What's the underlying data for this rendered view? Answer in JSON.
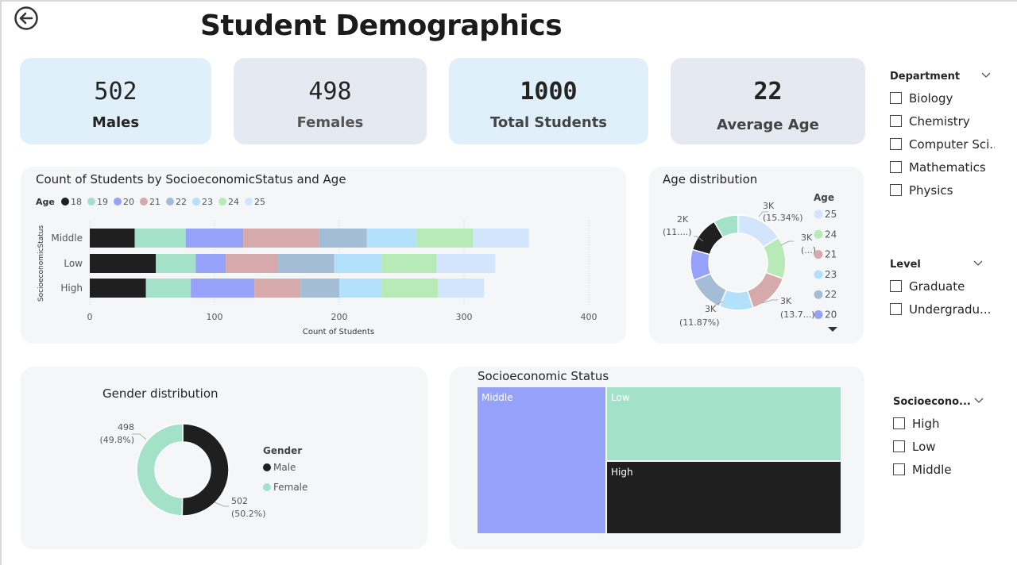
{
  "page": {
    "title": "Student Demographics"
  },
  "nav": {
    "back_icon": "back-arrow-icon"
  },
  "kpis": [
    {
      "value": "502",
      "label": "Males"
    },
    {
      "value": "498",
      "label": "Females"
    },
    {
      "value": "1000",
      "label": "Total Students"
    },
    {
      "value": "22",
      "label": "Average Age"
    }
  ],
  "colors": {
    "18": "#1f1f1f",
    "19": "#a3e2c9",
    "20": "#96a2f9",
    "21": "#d6a9aa",
    "22": "#a4bdd6",
    "23": "#b3e0fb",
    "24": "#b8eab8",
    "25": "#d2e5fc",
    "male": "#1f1f1f",
    "female": "#a3e2c9"
  },
  "bar_chart": {
    "title": "Count of Students by SocioeconomicStatus and Age",
    "legend_title": "Age",
    "legend": [
      "18",
      "19",
      "20",
      "21",
      "22",
      "23",
      "24",
      "25"
    ],
    "xlabel": "Count of Students",
    "ylabel": "SocioeconomicStatus",
    "ticks": [
      "0",
      "100",
      "200",
      "300",
      "400"
    ]
  },
  "age_chart": {
    "title": "Age distribution",
    "legend_title": "Age",
    "legend": [
      "25",
      "24",
      "21",
      "23",
      "22",
      "20"
    ],
    "labels": {
      "a": [
        "3K",
        "(15.34%)"
      ],
      "b": [
        "3K",
        "(...)"
      ],
      "c": [
        "3K",
        "(13.7...)"
      ],
      "d": [
        "3K",
        "(11.87%)"
      ],
      "e": [
        "2K",
        "(11....)"
      ]
    }
  },
  "gender_chart": {
    "title": "Gender distribution",
    "legend_title": "Gender",
    "legend": [
      "Male",
      "Female"
    ],
    "labels": {
      "female": [
        "498",
        "(49.8%)"
      ],
      "male": [
        "502",
        "(50.2%)"
      ]
    }
  },
  "treemap": {
    "title": "Socioeconomic Status",
    "cells": [
      "Middle",
      "Low",
      "High"
    ]
  },
  "slicers": {
    "department": {
      "title": "Department",
      "items": [
        "Biology",
        "Chemistry",
        "Computer Sci...",
        "Mathematics",
        "Physics"
      ]
    },
    "level": {
      "title": "Level",
      "items": [
        "Graduate",
        "Undergradu..."
      ]
    },
    "socio": {
      "title": "Socioecono...",
      "items": [
        "High",
        "Low",
        "Middle"
      ]
    }
  },
  "chart_data": [
    {
      "type": "bar",
      "title": "Count of Students by SocioeconomicStatus and Age",
      "xlabel": "Count of Students",
      "ylabel": "SocioeconomicStatus",
      "xlim": [
        0,
        400
      ],
      "categories": [
        "Middle",
        "Low",
        "High"
      ],
      "series": [
        {
          "name": "18",
          "values": [
            36,
            53,
            45
          ]
        },
        {
          "name": "19",
          "values": [
            41,
            32,
            36
          ]
        },
        {
          "name": "20",
          "values": [
            46,
            24,
            51
          ]
        },
        {
          "name": "21",
          "values": [
            61,
            42,
            37
          ]
        },
        {
          "name": "22",
          "values": [
            38,
            45,
            31
          ]
        },
        {
          "name": "23",
          "values": [
            40,
            38,
            34
          ]
        },
        {
          "name": "24",
          "values": [
            45,
            44,
            45
          ]
        },
        {
          "name": "25",
          "values": [
            45,
            47,
            37
          ]
        }
      ]
    },
    {
      "type": "pie",
      "title": "Age distribution",
      "categories": [
        "25",
        "24",
        "21",
        "23",
        "22",
        "20",
        "18",
        "19"
      ],
      "values": [
        15.34,
        13.6,
        13.7,
        11.0,
        11.87,
        10.0,
        11.5,
        8.0
      ]
    },
    {
      "type": "pie",
      "title": "Gender distribution",
      "categories": [
        "Male",
        "Female"
      ],
      "values": [
        502,
        498
      ]
    },
    {
      "type": "treemap",
      "title": "Socioeconomic Status",
      "categories": [
        "Middle",
        "Low",
        "High"
      ],
      "values": [
        350,
        325,
        315
      ]
    }
  ]
}
